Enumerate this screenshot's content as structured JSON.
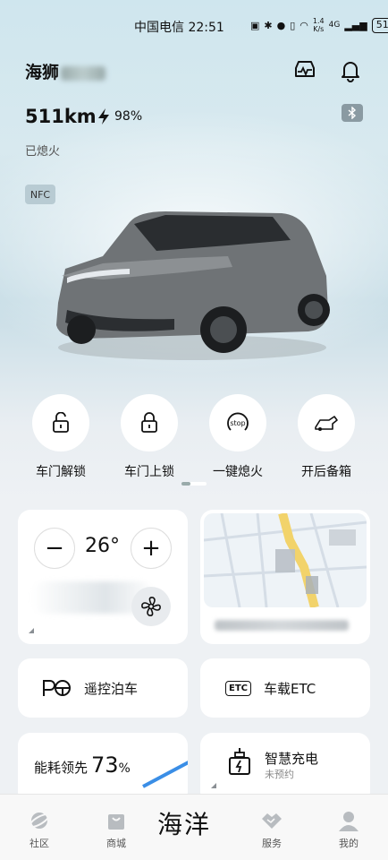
{
  "status_bar": {
    "carrier": "中国电信",
    "time": "22:51",
    "net_speed": "1.4",
    "net_unit": "K/s",
    "network": "4G",
    "battery": "51"
  },
  "vehicle": {
    "name": "海狮",
    "range": "511km",
    "charge": "98%",
    "engine_status": "已熄火",
    "nfc": "NFC"
  },
  "quick_actions": [
    {
      "label": "车门解锁",
      "icon": "unlock-icon"
    },
    {
      "label": "车门上锁",
      "icon": "lock-icon"
    },
    {
      "label": "一键熄火",
      "icon": "stop-icon",
      "icon_text": "stop"
    },
    {
      "label": "开后备箱",
      "icon": "trunk-icon"
    }
  ],
  "climate": {
    "minus": "−",
    "temperature": "26°",
    "plus": "+"
  },
  "cards": {
    "parking": "遥控泊车",
    "etc_badge": "ETC",
    "etc": "车载ETC",
    "energy_label": "能耗领先",
    "energy_value": "73",
    "energy_unit": "%",
    "charging_title": "智慧充电",
    "charging_sub": "未预约"
  },
  "bottom_nav": {
    "community": "社区",
    "mall": "商城",
    "brand": "海洋",
    "service": "服务",
    "mine": "我的"
  },
  "colors": {
    "accent_blue": "#3a8ee6",
    "route_yellow": "#f2d36b"
  }
}
